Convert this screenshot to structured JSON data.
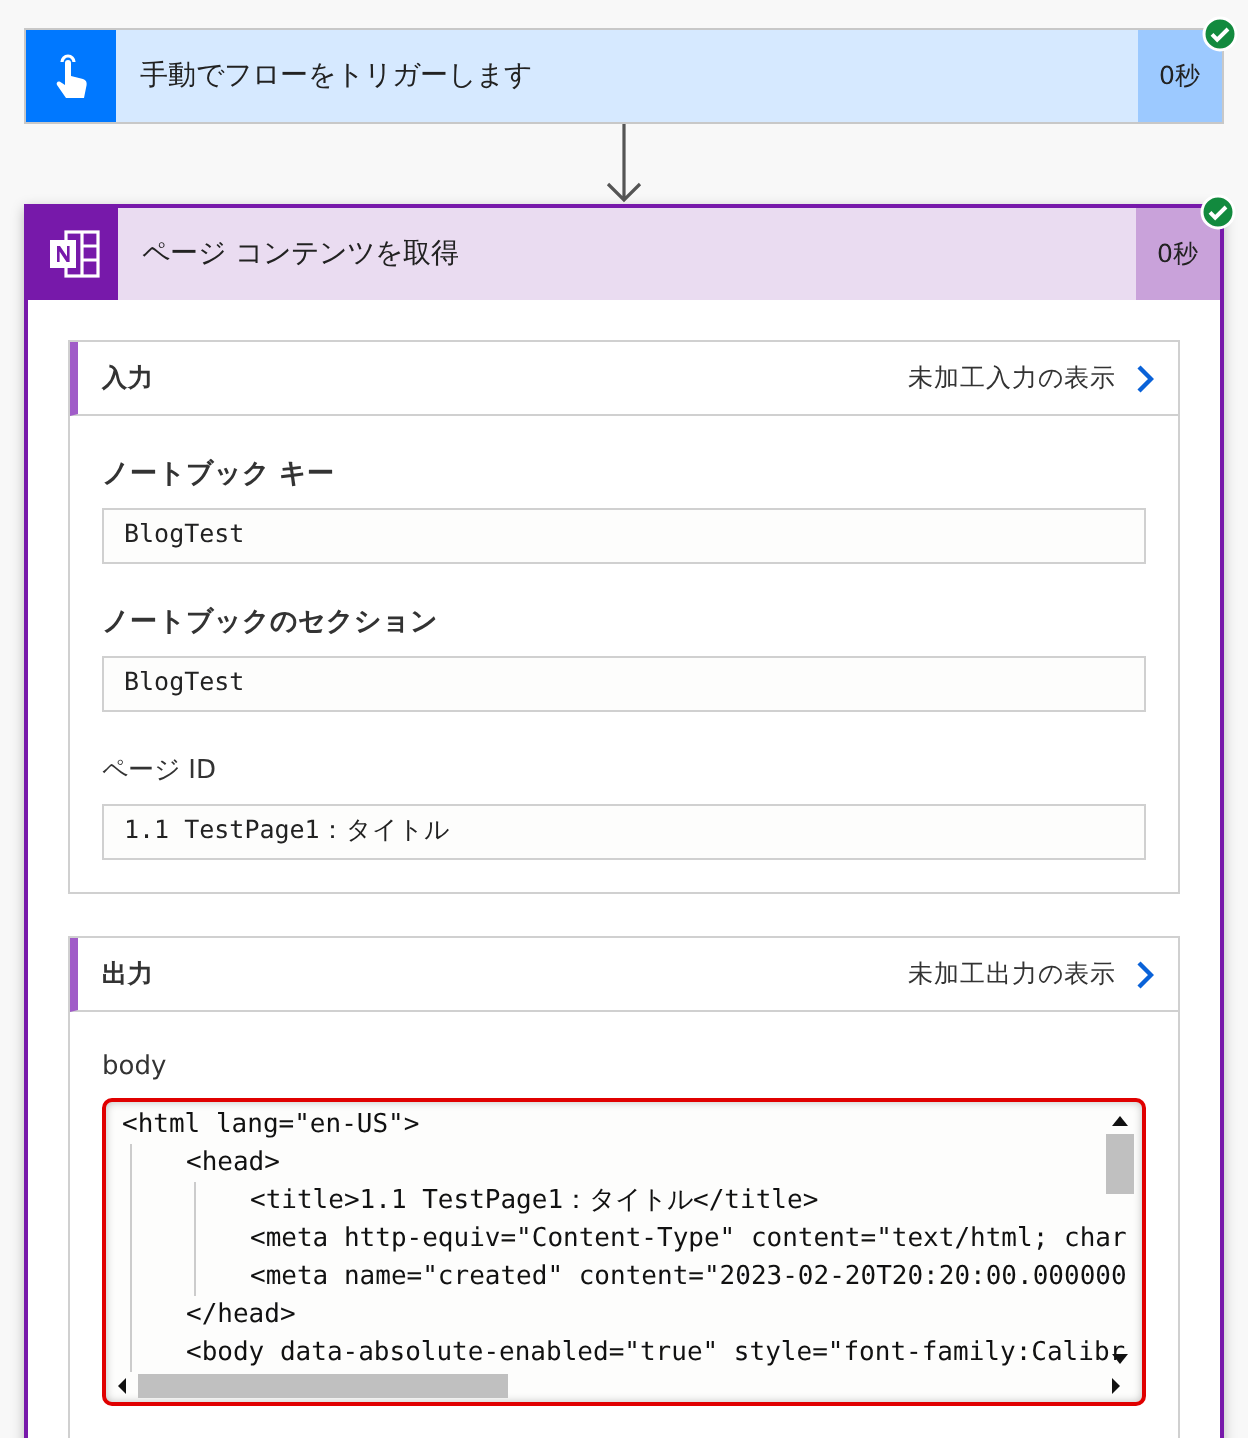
{
  "steps": [
    {
      "kind": "trigger",
      "title": "手動でフローをトリガーします",
      "duration": "0秒",
      "succeeded": true
    },
    {
      "kind": "onenote",
      "title": "ページ コンテンツを取得",
      "duration": "0秒",
      "succeeded": true,
      "sections": [
        {
          "title": "入力",
          "link": "未加工入力の表示",
          "params": [
            {
              "label": "ノートブック キー",
              "strong": true,
              "value": "BlogTest"
            },
            {
              "label": "ノートブックのセクション",
              "strong": true,
              "value": "BlogTest"
            },
            {
              "label": "ページ ID",
              "strong": false,
              "value": "1.1 TestPage1：タイトル"
            }
          ]
        },
        {
          "title": "出力",
          "link": "未加工出力の表示",
          "code_label": "body",
          "highlighted": true,
          "code": [
            {
              "text": "<html lang=\"en-US\">",
              "children": [
                {
                  "text": "<head>",
                  "children": [
                    {
                      "text": "<title>1.1 TestPage1：タイトル</title>"
                    },
                    {
                      "text": "<meta http-equiv=\"Content-Type\" content=\"text/html; char"
                    },
                    {
                      "text": "<meta name=\"created\" content=\"2023-02-20T20:20:00.000000"
                    }
                  ]
                },
                {
                  "text": "</head>"
                },
                {
                  "text": "<body data-absolute-enabled=\"true\" style=\"font-family:Calibr"
                }
              ]
            }
          ]
        }
      ]
    }
  ]
}
